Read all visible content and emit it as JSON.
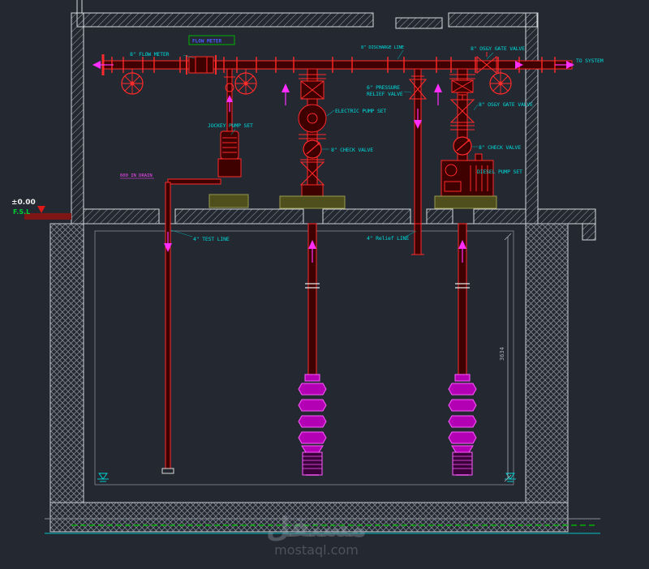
{
  "colors": {
    "background": "#232831",
    "pipe_red": "#ff2a2a",
    "pipe_fill": "#3f0000",
    "label_cyan": "#00dcdc",
    "pump_magenta": "#ff2eff",
    "bowl_fill": "#b400b4",
    "structure_outline": "#d5dae0",
    "hatch_gray": "#99a0a8",
    "green_line": "#00c800",
    "fsl_green": "#00cc33",
    "marker_red": "#e01818",
    "grade_strip": "#7e1616",
    "dim_gray": "#aab0b8",
    "tag_box_green": "#00b400",
    "tag_text_blue": "#4b5bff",
    "watermark_gray": "#9aa2ae"
  },
  "labels": {
    "flow_meter": "8\" FLOW METER",
    "flow_meter_tag": "FLOW METER",
    "discharge_line": "8\" DISCHARGE LINE",
    "osy_gate_valve_top": "8\" OS&Y GATE VALVE",
    "to_system": "TO SYSTEM",
    "pressure_relief_1": "6\" PRESSURE",
    "pressure_relief_2": "RELIEF VALVE",
    "electric_pump_set": "ELECTRIC PUMP SET",
    "jockey_pump_set": "JOCKEY PUMP SET",
    "osy_gate_valve_diesel": "8\" OS&Y GATE VALVE",
    "check_valve_electric": "8\" CHECK VALVE",
    "check_valve_diesel": "8\" CHECK VALVE",
    "diesel_pump_set": "DIESEL PUMP SET",
    "drain_line": "600 IN DRAIN",
    "ground_level": "±0.00",
    "fsl": "F.S.L",
    "test_line": "4\" TEST LINE",
    "relief_line": "4\" Relief LINE",
    "dim_depth": "3634",
    "watermark_ar": "مستقل",
    "watermark_en": "mostaql.com"
  }
}
